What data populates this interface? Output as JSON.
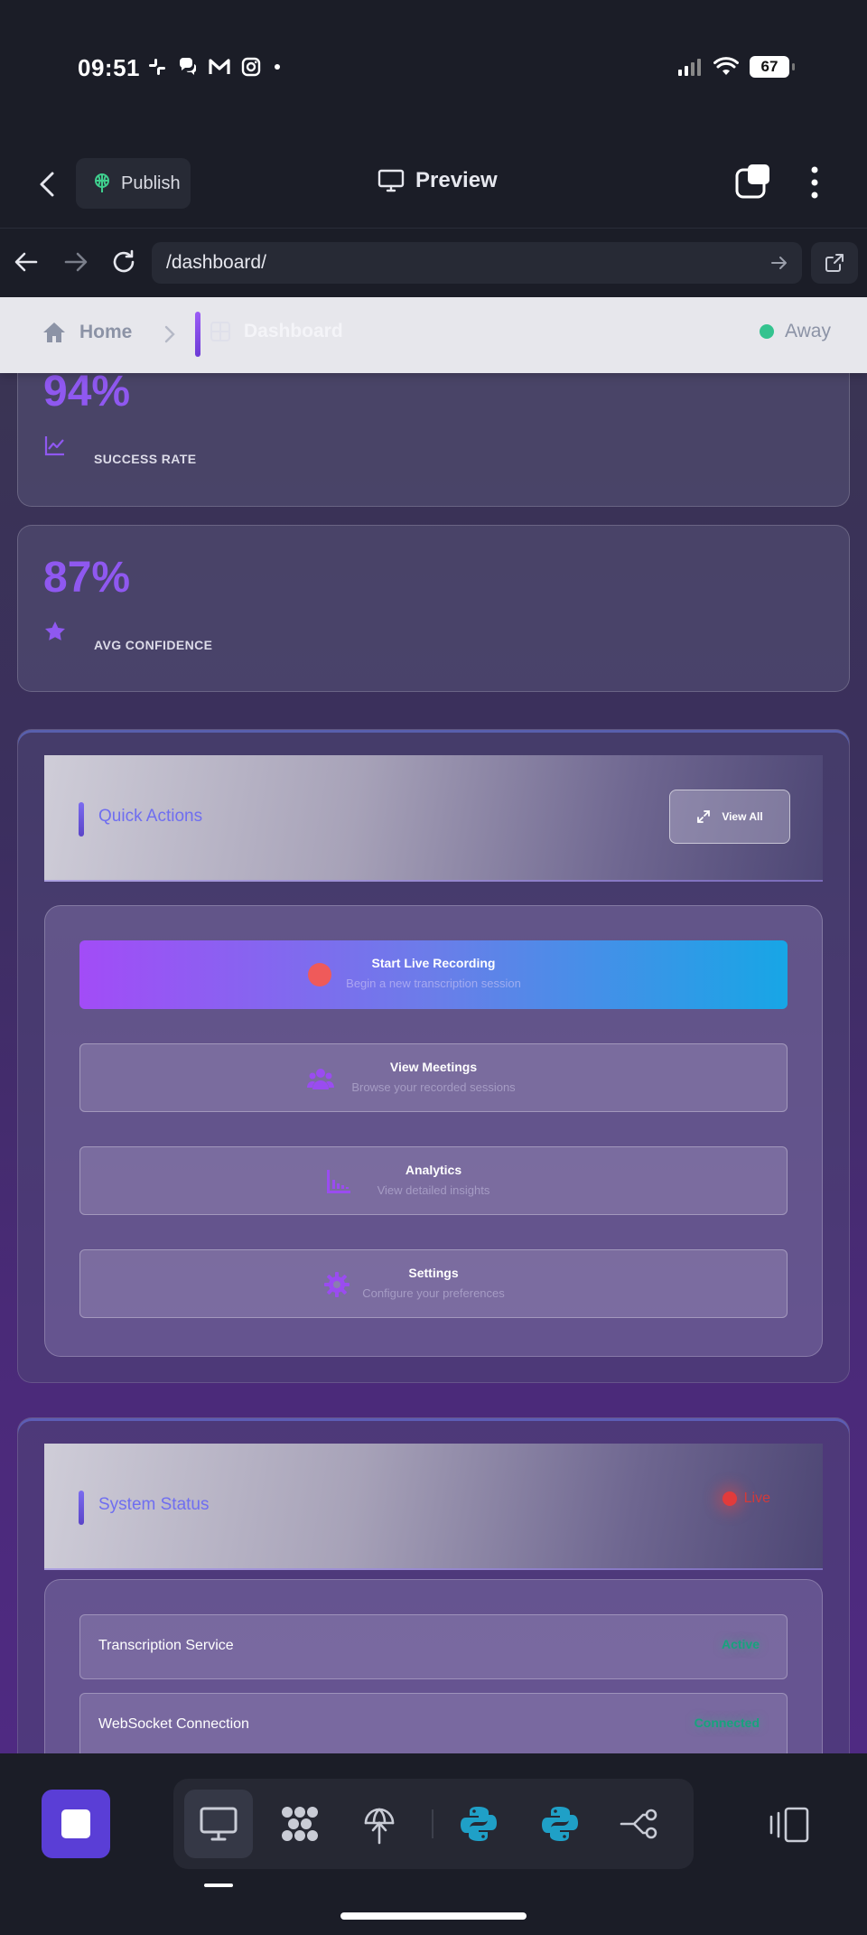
{
  "status_bar": {
    "time": "09:51",
    "battery": "67"
  },
  "header": {
    "publish_label": "Publish",
    "preview_label": "Preview"
  },
  "url_bar": {
    "url": "/dashboard/"
  },
  "breadcrumb": {
    "home": "Home",
    "current": "Dashboard",
    "presence": "Away"
  },
  "stats": [
    {
      "value": "94%",
      "label": "SUCCESS RATE",
      "icon": "trend-chart-icon"
    },
    {
      "value": "87%",
      "label": "AVG CONFIDENCE",
      "icon": "star-icon"
    }
  ],
  "quick_actions": {
    "title": "Quick Actions",
    "view_all": "View All",
    "items": [
      {
        "title": "Start Live Recording",
        "subtitle": "Begin a new transcription session",
        "icon": "record-dot-icon"
      },
      {
        "title": "View Meetings",
        "subtitle": "Browse your recorded sessions",
        "icon": "users-icon"
      },
      {
        "title": "Analytics",
        "subtitle": "View detailed insights",
        "icon": "bar-chart-icon"
      },
      {
        "title": "Settings",
        "subtitle": "Configure your preferences",
        "icon": "gear-icon"
      }
    ]
  },
  "system_status": {
    "title": "System Status",
    "live_label": "Live",
    "rows": [
      {
        "label": "Transcription Service",
        "status": "Active"
      },
      {
        "label": "WebSocket Connection",
        "status": "Connected"
      }
    ]
  },
  "colors": {
    "accent_purple": "#8f58f0",
    "status_green": "#17a37d",
    "live_red": "#e23b3b",
    "dock_stop": "#5a3ed6"
  }
}
